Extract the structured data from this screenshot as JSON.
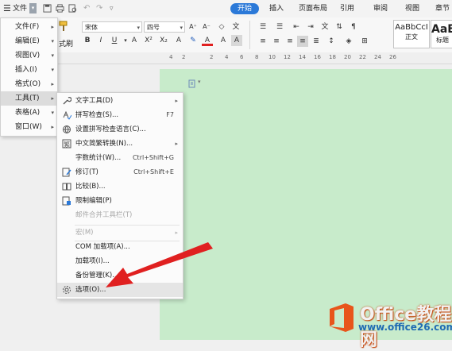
{
  "menubar": {
    "file_label": "文件",
    "tabs": [
      {
        "label": "开始",
        "active": true
      },
      {
        "label": "插入"
      },
      {
        "label": "页面布局"
      },
      {
        "label": "引用"
      },
      {
        "label": "审阅"
      },
      {
        "label": "视图"
      },
      {
        "label": "章节"
      }
    ]
  },
  "ribbon": {
    "format_painter_label": "式刷",
    "font_name": "宋体",
    "font_size": "四号",
    "styles": [
      {
        "sample": "AaBbCcI",
        "label": "正文"
      },
      {
        "sample": "AaE",
        "label": "标题"
      }
    ]
  },
  "ruler": {
    "numbers": [
      "4",
      "2",
      "2",
      "4",
      "6",
      "8",
      "10",
      "12",
      "14",
      "16",
      "18",
      "20",
      "22",
      "24",
      "26"
    ]
  },
  "left_menu": {
    "items": [
      {
        "label": "文件(F)"
      },
      {
        "label": "编辑(E)"
      },
      {
        "label": "视图(V)"
      },
      {
        "label": "插入(I)"
      },
      {
        "label": "格式(O)"
      },
      {
        "label": "工具(T)",
        "active": true
      },
      {
        "label": "表格(A)"
      },
      {
        "label": "窗口(W)"
      }
    ]
  },
  "tools_menu": {
    "items": [
      {
        "label": "文字工具(D)",
        "icon": "wrench-icon",
        "submenu": true
      },
      {
        "label": "拼写检查(S)...",
        "icon": "spell-check-icon",
        "shortcut": "F7"
      },
      {
        "label": "设置拼写检查语言(C)...",
        "icon": "globe-icon"
      },
      {
        "label": "中文简繁转换(N)...",
        "icon": "convert-icon",
        "submenu": true
      },
      {
        "label": "字数统计(W)...",
        "shortcut": "Ctrl+Shift+G"
      },
      {
        "label": "修订(T)",
        "icon": "track-changes-icon",
        "shortcut": "Ctrl+Shift+E"
      },
      {
        "label": "比较(B)...",
        "icon": "compare-icon"
      },
      {
        "label": "限制编辑(P)",
        "icon": "restrict-editing-icon"
      },
      {
        "label": "邮件合并工具栏(T)",
        "disabled": true
      },
      {
        "label": "宏(M)",
        "disabled": true,
        "submenu": true
      },
      {
        "label": "COM 加载项(A)..."
      },
      {
        "label": "加载项(I)..."
      },
      {
        "label": "备份管理(K)..."
      },
      {
        "label": "选项(O)...",
        "icon": "gear-icon",
        "active": true
      }
    ]
  },
  "watermark": {
    "title": "Office教程网",
    "url": "www.office26.com"
  },
  "colors": {
    "accent": "#2b79d8",
    "page": "#c8ebcb",
    "arrow": "#e02020",
    "logo": "#e8551b"
  }
}
